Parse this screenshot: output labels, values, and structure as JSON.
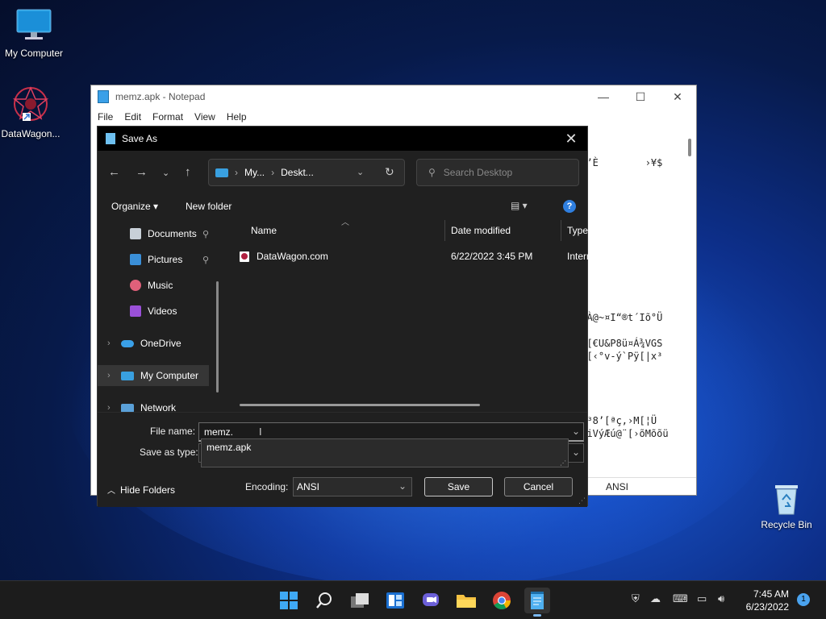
{
  "desktop": {
    "icons": [
      {
        "label": "My Computer"
      },
      {
        "label": "DataWagon..."
      },
      {
        "label": "Recycle Bin"
      }
    ]
  },
  "notepad": {
    "title": "memz.apk - Notepad",
    "menu": [
      "File",
      "Edit",
      "Format",
      "View",
      "Help"
    ],
    "text_lines": [
      "od’È        ›¥$",
      "",
      "",
      "",
      "",
      "",
      "",
      "",
      "",
      "",
      "",
      "",
      "ZbÀ@~¤I“®t´Iõ°Ü",
      "",
      "Ôh[€U&P8ü¤Á¾VGS",
      "ÝQ[‹°v-ý`Pÿ[|x³",
      "",
      "",
      "",
      "",
      "Õ§³8’[ªç,›M[¦Ü",
      "©%iVýÆú@¨[›õMõõü"
    ],
    "status_encoding": "ANSI"
  },
  "dialog": {
    "title": "Save As",
    "breadcrumb": [
      "My...",
      "Deskt..."
    ],
    "search_placeholder": "Search Desktop",
    "organize_label": "Organize",
    "new_folder_label": "New folder",
    "nav_items": [
      {
        "label": "Documents"
      },
      {
        "label": "Pictures"
      },
      {
        "label": "Music"
      },
      {
        "label": "Videos"
      },
      {
        "label": "OneDrive"
      },
      {
        "label": "My Computer"
      },
      {
        "label": "Network"
      }
    ],
    "columns": {
      "name": "Name",
      "date": "Date modified",
      "type": "Type"
    },
    "files": [
      {
        "name": "DataWagon.com",
        "date": "6/22/2022 3:45 PM",
        "type": "Intern"
      }
    ],
    "file_name_label": "File name:",
    "file_name_value": "memz.",
    "autocomplete": "memz.apk",
    "save_type_label": "Save as type:",
    "hide_folders_label": "Hide Folders",
    "encoding_label": "Encoding:",
    "encoding_value": "ANSI",
    "save_label": "Save",
    "cancel_label": "Cancel"
  },
  "taskbar": {
    "time": "7:45 AM",
    "date": "6/23/2022",
    "notifications": "1"
  }
}
